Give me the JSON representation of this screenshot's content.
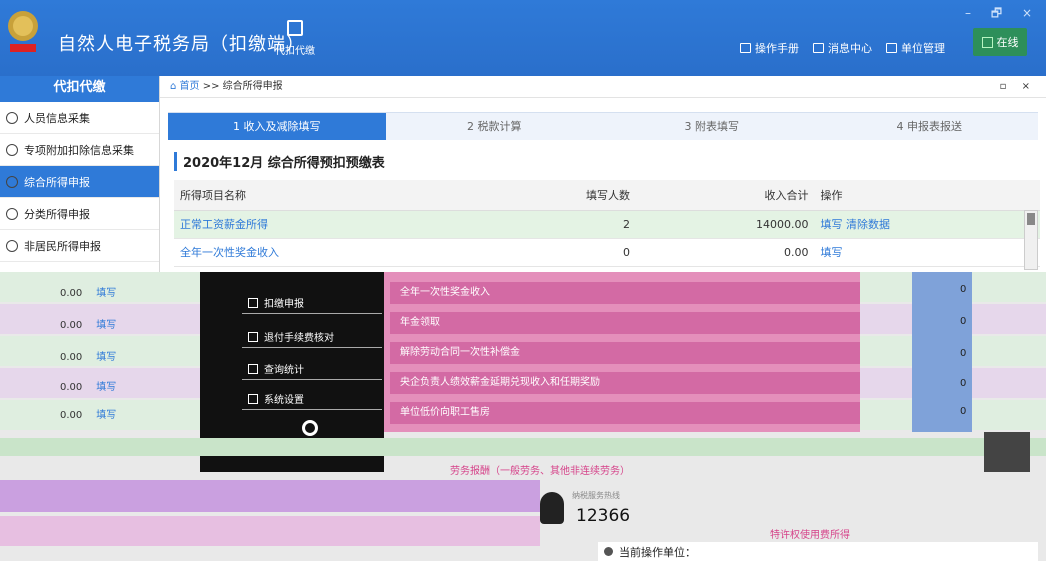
{
  "app": {
    "title": "自然人电子税务局（扣缴端）",
    "proxy_label": "代扣代缴"
  },
  "top_menu": [
    "操作手册",
    "消息中心",
    "单位管理"
  ],
  "status": {
    "online": "在线"
  },
  "window_controls": "– 🗗 ×",
  "sidebar": {
    "header": "代扣代缴",
    "items": [
      {
        "label": "人员信息采集"
      },
      {
        "label": "专项附加扣除信息采集"
      },
      {
        "label": "综合所得申报"
      },
      {
        "label": "分类所得申报"
      },
      {
        "label": "非居民所得申报"
      }
    ]
  },
  "breadcrumb": {
    "home": "首页",
    "sep": ">>",
    "current": "综合所得申报",
    "controls": "▫ ×"
  },
  "steps": [
    {
      "label": "1 收入及减除填写"
    },
    {
      "label": "2 税款计算"
    },
    {
      "label": "3 附表填写"
    },
    {
      "label": "4 申报表报送"
    }
  ],
  "form": {
    "title": "2020年12月 综合所得预扣预缴表",
    "columns": [
      "所得项目名称",
      "填写人数",
      "收入合计",
      "操作"
    ],
    "rows": [
      {
        "name": "正常工资薪金所得",
        "count": "2",
        "income": "14000.00",
        "op1": "填写",
        "op2": "清除数据"
      },
      {
        "name": "全年一次性奖金收入",
        "count": "0",
        "income": "0.00",
        "op1": "填写",
        "op2": ""
      }
    ]
  },
  "lower": {
    "row_values": [
      "0.00",
      "0.00",
      "0.00",
      "0.00",
      "0.00"
    ],
    "fill_label": "填写",
    "dropdown": [
      "扣缴申报",
      "退付手续费核对",
      "查询统计",
      "系统设置"
    ],
    "income_items": [
      "全年一次性奖金收入",
      "年金领取",
      "解除劳动合同一次性补偿金",
      "央企负责人绩效薪金延期兑现收入和任期奖励",
      "单位低价向职工售房"
    ],
    "zeros": [
      "0",
      "0",
      "0",
      "0",
      "0"
    ],
    "labor_item": "劳务报酬（一般劳务、其他非连续劳务）",
    "other_item": "特许权使用费所得",
    "hotline_label": "纳税服务热线",
    "hotline": "12366",
    "current_unit_label": "当前操作单位："
  }
}
